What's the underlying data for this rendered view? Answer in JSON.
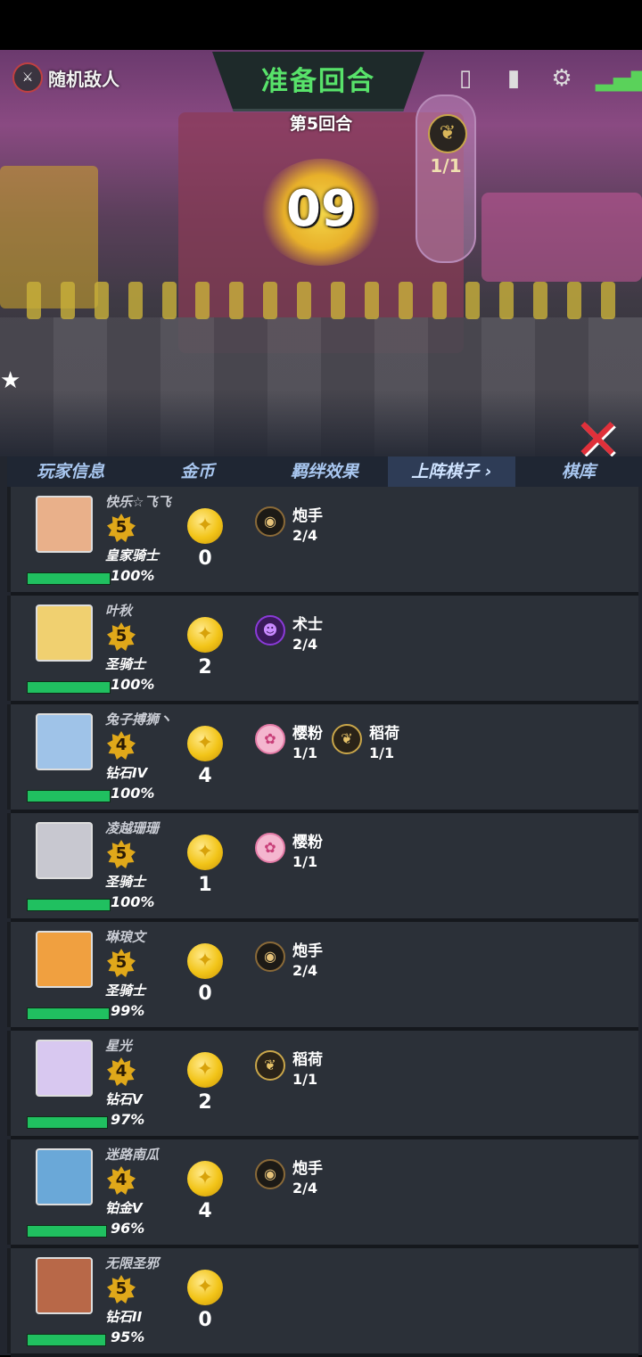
{
  "hud": {
    "opponent_label": "随机敌人",
    "phase_title": "准备回合",
    "round_label": "第5回合",
    "timer": "09",
    "population": "1/1",
    "icons": [
      "phone-swap-icon",
      "book-icon",
      "gear-icon",
      "signal-icon"
    ]
  },
  "tabs": [
    "玩家信息",
    "金币",
    "羁绊效果",
    "上阵棋子 ›",
    "棋库"
  ],
  "active_tab": "上阵棋子 ›",
  "players": [
    {
      "name": "快乐☆飞飞",
      "level": "5",
      "rank": "皇家骑士",
      "hp": "100%",
      "hp_fraction": 1.0,
      "gold": "0",
      "synergies": [
        {
          "icon": "cannon-icon",
          "name": "炮手",
          "count": "2/4"
        }
      ]
    },
    {
      "name": "叶秋",
      "level": "5",
      "rank": "圣骑士",
      "hp": "100%",
      "hp_fraction": 1.0,
      "gold": "2",
      "synergies": [
        {
          "icon": "warlock-icon",
          "name": "术士",
          "count": "2/4"
        }
      ]
    },
    {
      "name": "兔子搏狮丶",
      "level": "4",
      "rank": "钻石IV",
      "hp": "100%",
      "hp_fraction": 1.0,
      "gold": "4",
      "synergies": [
        {
          "icon": "sakura-icon",
          "name": "樱粉",
          "count": "1/1"
        },
        {
          "icon": "rice-icon",
          "name": "稻荷",
          "count": "1/1"
        }
      ]
    },
    {
      "name": "凌越珊珊",
      "level": "5",
      "rank": "圣骑士",
      "hp": "100%",
      "hp_fraction": 1.0,
      "gold": "1",
      "synergies": [
        {
          "icon": "sakura-icon",
          "name": "樱粉",
          "count": "1/1"
        }
      ]
    },
    {
      "name": "琳琅文",
      "level": "5",
      "rank": "圣骑士",
      "hp": "99%",
      "hp_fraction": 0.99,
      "gold": "0",
      "synergies": [
        {
          "icon": "cannon-icon",
          "name": "炮手",
          "count": "2/4"
        }
      ]
    },
    {
      "name": "星光",
      "level": "4",
      "rank": "钻石V",
      "hp": "97%",
      "hp_fraction": 0.97,
      "gold": "2",
      "synergies": [
        {
          "icon": "rice-icon",
          "name": "稻荷",
          "count": "1/1"
        }
      ]
    },
    {
      "name": "迷路南瓜",
      "level": "4",
      "rank": "铂金V",
      "hp": "96%",
      "hp_fraction": 0.96,
      "gold": "4",
      "synergies": [
        {
          "icon": "cannon-icon",
          "name": "炮手",
          "count": "2/4"
        }
      ]
    },
    {
      "name": "无限圣邪",
      "level": "5",
      "rank": "钻石II",
      "hp": "95%",
      "hp_fraction": 0.95,
      "gold": "0",
      "synergies": []
    }
  ],
  "colors": {
    "hp_green": "#20c060",
    "phase_green": "#58e26a",
    "gold": "#f2c418",
    "tab_active": "#2e3c56"
  }
}
